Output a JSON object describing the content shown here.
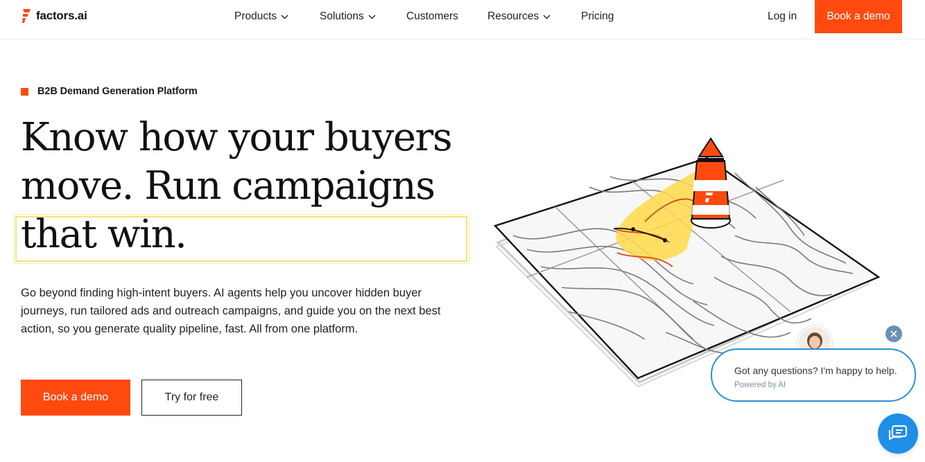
{
  "brand": {
    "name": "factors.ai",
    "accent": "#ff4a0f"
  },
  "nav": {
    "items": [
      {
        "label": "Products",
        "has_dropdown": true
      },
      {
        "label": "Solutions",
        "has_dropdown": true
      },
      {
        "label": "Customers",
        "has_dropdown": false
      },
      {
        "label": "Resources",
        "has_dropdown": true
      },
      {
        "label": "Pricing",
        "has_dropdown": false
      }
    ],
    "login_label": "Log in",
    "book_demo_label": "Book a demo"
  },
  "hero": {
    "eyebrow": "B2B Demand Generation Platform",
    "headline_lines": [
      "Know how your buyers",
      "move. Run campaigns",
      "that win."
    ],
    "description": "Go beyond finding high-intent buyers. AI agents help you uncover hidden buyer journeys, run tailored ads and outreach campaigns, and guide you on the next best action, so you generate quality pipeline, fast. All from one platform.",
    "primary_cta": "Book a demo",
    "secondary_cta": "Try for free"
  },
  "chat": {
    "message": "Got any questions? I'm happy to help.",
    "powered_by": "Powered by AI",
    "accent": "#1f8ee6"
  },
  "icons": [
    "factors-logo-icon",
    "chevron-down-icon",
    "close-icon",
    "chat-icon",
    "lighthouse-map-illustration"
  ]
}
